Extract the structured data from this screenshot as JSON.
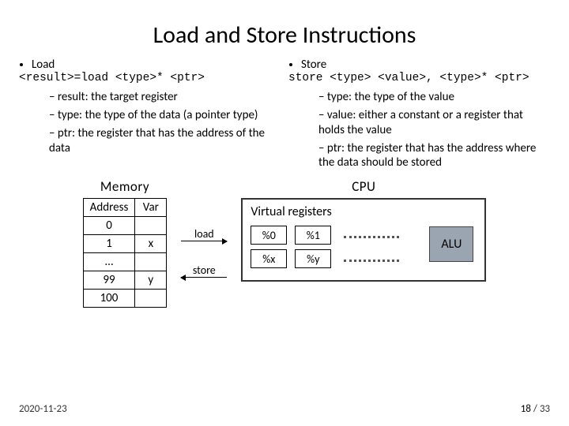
{
  "title": "Load and Store Instructions",
  "left": {
    "heading": "Load",
    "syntax": "<result>=load <type>* <ptr>",
    "defs": [
      "result: the target register",
      "type: the type of the data (a pointer type)",
      "ptr: the register that has the address of the data"
    ]
  },
  "right": {
    "heading": "Store",
    "syntax": "store <type> <value>, <type>* <ptr>",
    "defs": [
      "type: the type of the value",
      "value: either a constant or a register that holds the value",
      "ptr: the register that has the address where the data should be stored"
    ]
  },
  "diagram": {
    "memory_label": "Memory",
    "cpu_label": "CPU",
    "table": {
      "h1": "Address",
      "h2": "Var",
      "rows": [
        {
          "addr": "0",
          "var": ""
        },
        {
          "addr": "1",
          "var": "x"
        },
        {
          "addr": "…",
          "var": ""
        },
        {
          "addr": "99",
          "var": "y"
        },
        {
          "addr": "100",
          "var": ""
        }
      ]
    },
    "load_label": "load",
    "store_label": "store",
    "vreg_label": "Virtual registers",
    "regs": [
      "%0",
      "%1",
      "%x",
      "%y"
    ],
    "alu": "ALU"
  },
  "footer": {
    "date": "2020-11-23",
    "page_cur": "18",
    "page_total": "33"
  }
}
